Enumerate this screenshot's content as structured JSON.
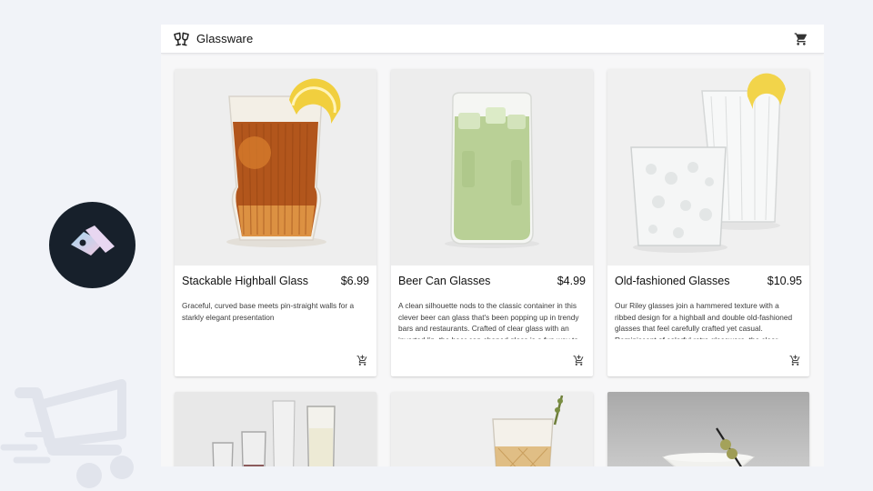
{
  "app": {
    "title": "Glassware",
    "brand_icon": "glasses-cheers-icon",
    "cart_icon": "shopping-cart-icon"
  },
  "products": [
    {
      "name": "Stackable Highball Glass",
      "price": "$6.99",
      "description": "Graceful, curved base meets pin-straight walls for a starkly elegant presentation",
      "image_icon": "highball-glass-image"
    },
    {
      "name": "Beer Can Glasses",
      "price": "$4.99",
      "description": "A clean silhouette nods to the classic container in this clever beer can glass that's been popping up in trendy bars and restaurants. Crafted of clear glass with an inverted lip, the beer can-shaped glass is a fun way to",
      "image_icon": "beer-can-glass-image"
    },
    {
      "name": "Old-fashioned Glasses",
      "price": "$10.95",
      "description": "Our Riley glasses join a hammered texture with a ribbed design for a highball and double old-fashioned glasses that feel carefully crafted yet casual. Reminiscent of colorful retro glassware, the clear",
      "image_icon": "old-fashioned-glasses-image"
    },
    {
      "image_icon": "wine-glasses-image"
    },
    {
      "image_icon": "crystal-tumbler-image"
    },
    {
      "image_icon": "martini-glass-image"
    }
  ],
  "colors": {
    "page_background": "#f1f3f8",
    "logo_circle": "#17202b",
    "card_background": "#ffffff"
  }
}
